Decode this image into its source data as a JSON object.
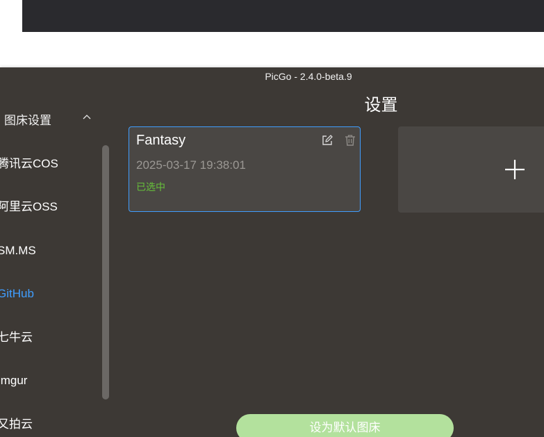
{
  "window": {
    "title": "PicGo - 2.4.0-beta.9"
  },
  "sidebar": {
    "section_label": "图床设置",
    "items": [
      {
        "label": "腾讯云COS",
        "active": false
      },
      {
        "label": "阿里云OSS",
        "active": false
      },
      {
        "label": "SM.MS",
        "active": false
      },
      {
        "label": "GitHub",
        "active": true
      },
      {
        "label": "七牛云",
        "active": false
      },
      {
        "label": "Imgur",
        "active": false
      },
      {
        "label": "又拍云",
        "active": false
      }
    ]
  },
  "main": {
    "title": "设置",
    "config_card": {
      "name": "Fantasy",
      "date": "2025-03-17 19:38:01",
      "status": "已选中",
      "edit_icon": "edit-icon",
      "delete_icon": "trash-icon"
    },
    "add_icon": "plus-icon",
    "default_button_label": "设为默认图床"
  },
  "colors": {
    "background": "#3d3935",
    "accent": "#409eff",
    "selected_text": "#67c23a",
    "button": "#b3e19d"
  }
}
